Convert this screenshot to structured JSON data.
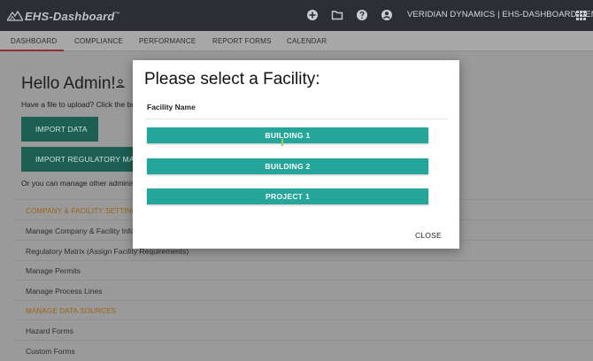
{
  "header": {
    "logo_text": "EHS-Dashboard",
    "logo_tm": "™",
    "company_label": "VERIDIAN DYNAMICS | EHS-DASHBOARD DEMO",
    "icons": [
      "add-circle-icon",
      "folder-icon",
      "help-icon",
      "account-circle-icon",
      "apps-grid-icon"
    ]
  },
  "nav": {
    "tabs": [
      {
        "label": "DASHBOARD",
        "active": true
      },
      {
        "label": "COMPLIANCE"
      },
      {
        "label": "PERFORMANCE"
      },
      {
        "label": "REPORT FORMS"
      },
      {
        "label": "CALENDAR"
      }
    ]
  },
  "page": {
    "greeting": "Hello Admin!",
    "upload_prompt": "Have a file to upload? Click the butto",
    "import_data_button": "IMPORT DATA",
    "import_regulatory_button": "IMPORT REGULATORY MAT",
    "manage_prompt": "Or you can manage other administra",
    "section_company": "COMPANY & FACILITY SETTING",
    "links_company": [
      "Manage Company & Facility Inform",
      "Regulatory Matrix (Assign Facility Requirements)",
      "Manage Permits",
      "Manage Process Lines"
    ],
    "section_data": "MANAGE DATA SOURCES",
    "links_data": [
      "Hazard Forms",
      "Custom Forms"
    ]
  },
  "modal": {
    "title": "Please select a Facility:",
    "column_header": "Facility Name",
    "facilities": [
      "BUILDING 1",
      "BUILDING 2",
      "PROJECT 1"
    ],
    "close_label": "CLOSE"
  },
  "colors": {
    "header_bg": "#2b2e33",
    "accent_teal": "#26a69a",
    "section_orange": "#9a6312",
    "active_tab_underline": "#8b2f2f"
  }
}
